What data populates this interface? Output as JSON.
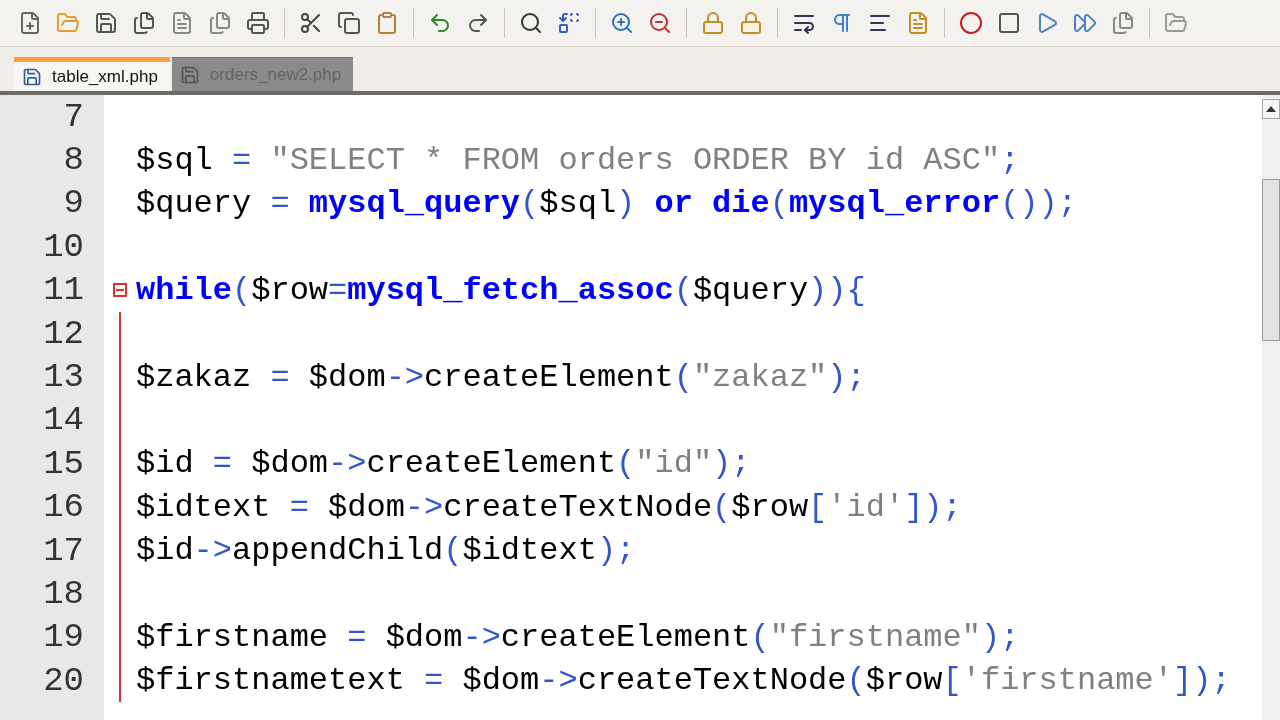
{
  "tabs": [
    {
      "label": "table_xml.php",
      "selected": true
    },
    {
      "label": "orders_new2.php",
      "selected": false
    }
  ],
  "editor": {
    "lines": [
      {
        "number": "7",
        "fold_start": false
      },
      {
        "number": "8",
        "fold_start": false,
        "tokens": [
          {
            "kind": "var",
            "text": "$sql"
          },
          {
            "kind": "op",
            "text": " = "
          },
          {
            "kind": "str",
            "text": "\"SELECT * FROM orders ORDER BY id ASC\""
          },
          {
            "kind": "op",
            "text": ";"
          }
        ]
      },
      {
        "number": "9",
        "fold_start": false,
        "tokens": [
          {
            "kind": "var",
            "text": "$query"
          },
          {
            "kind": "op",
            "text": " = "
          },
          {
            "kind": "func",
            "text": "mysql_query"
          },
          {
            "kind": "op",
            "text": "("
          },
          {
            "kind": "var",
            "text": "$sql"
          },
          {
            "kind": "op",
            "text": ") "
          },
          {
            "kind": "func",
            "text": "or die"
          },
          {
            "kind": "op",
            "text": "("
          },
          {
            "kind": "func",
            "text": "mysql_error"
          },
          {
            "kind": "op",
            "text": "());"
          }
        ]
      },
      {
        "number": "10",
        "fold_start": false
      },
      {
        "number": "11",
        "fold_start": true,
        "tokens": [
          {
            "kind": "func",
            "text": "while"
          },
          {
            "kind": "op",
            "text": "("
          },
          {
            "kind": "var",
            "text": "$row"
          },
          {
            "kind": "op",
            "text": "="
          },
          {
            "kind": "func",
            "text": "mysql_fetch_assoc"
          },
          {
            "kind": "op",
            "text": "("
          },
          {
            "kind": "var",
            "text": "$query"
          },
          {
            "kind": "op",
            "text": ")){"
          }
        ]
      },
      {
        "number": "12",
        "fold_start": false
      },
      {
        "number": "13",
        "fold_start": false,
        "tokens": [
          {
            "kind": "var",
            "text": "$zakaz"
          },
          {
            "kind": "op",
            "text": " = "
          },
          {
            "kind": "var",
            "text": "$dom"
          },
          {
            "kind": "op",
            "text": "->"
          },
          {
            "kind": "var",
            "text": "createElement"
          },
          {
            "kind": "op",
            "text": "("
          },
          {
            "kind": "str",
            "text": "\"zakaz\""
          },
          {
            "kind": "op",
            "text": ");"
          }
        ]
      },
      {
        "number": "14",
        "fold_start": false
      },
      {
        "number": "15",
        "fold_start": false,
        "tokens": [
          {
            "kind": "var",
            "text": "$id"
          },
          {
            "kind": "op",
            "text": " = "
          },
          {
            "kind": "var",
            "text": "$dom"
          },
          {
            "kind": "op",
            "text": "->"
          },
          {
            "kind": "var",
            "text": "createElement"
          },
          {
            "kind": "op",
            "text": "("
          },
          {
            "kind": "str",
            "text": "\"id\""
          },
          {
            "kind": "op",
            "text": ");"
          }
        ]
      },
      {
        "number": "16",
        "fold_start": false,
        "tokens": [
          {
            "kind": "var",
            "text": "$idtext"
          },
          {
            "kind": "op",
            "text": " = "
          },
          {
            "kind": "var",
            "text": "$dom"
          },
          {
            "kind": "op",
            "text": "->"
          },
          {
            "kind": "var",
            "text": "createTextNode"
          },
          {
            "kind": "op",
            "text": "("
          },
          {
            "kind": "var",
            "text": "$row"
          },
          {
            "kind": "op",
            "text": "["
          },
          {
            "kind": "str",
            "text": "'id'"
          },
          {
            "kind": "op",
            "text": "]);"
          }
        ]
      },
      {
        "number": "17",
        "fold_start": false,
        "tokens": [
          {
            "kind": "var",
            "text": "$id"
          },
          {
            "kind": "op",
            "text": "->"
          },
          {
            "kind": "var",
            "text": "appendChild"
          },
          {
            "kind": "op",
            "text": "("
          },
          {
            "kind": "var",
            "text": "$idtext"
          },
          {
            "kind": "op",
            "text": ");"
          }
        ]
      },
      {
        "number": "18",
        "fold_start": false
      },
      {
        "number": "19",
        "fold_start": false,
        "tokens": [
          {
            "kind": "var",
            "text": "$firstname"
          },
          {
            "kind": "op",
            "text": " = "
          },
          {
            "kind": "var",
            "text": "$dom"
          },
          {
            "kind": "op",
            "text": "->"
          },
          {
            "kind": "var",
            "text": "createElement"
          },
          {
            "kind": "op",
            "text": "("
          },
          {
            "kind": "str",
            "text": "\"firstname\""
          },
          {
            "kind": "op",
            "text": ");"
          }
        ]
      },
      {
        "number": "20",
        "fold_start": false,
        "tokens": [
          {
            "kind": "var",
            "text": "$firstnametext"
          },
          {
            "kind": "op",
            "text": " = "
          },
          {
            "kind": "var",
            "text": "$dom"
          },
          {
            "kind": "op",
            "text": "->"
          },
          {
            "kind": "var",
            "text": "createTextNode"
          },
          {
            "kind": "op",
            "text": "("
          },
          {
            "kind": "var",
            "text": "$row"
          },
          {
            "kind": "op",
            "text": "["
          },
          {
            "kind": "str",
            "text": "'firstname'"
          },
          {
            "kind": "op",
            "text": "]);"
          }
        ]
      }
    ]
  }
}
